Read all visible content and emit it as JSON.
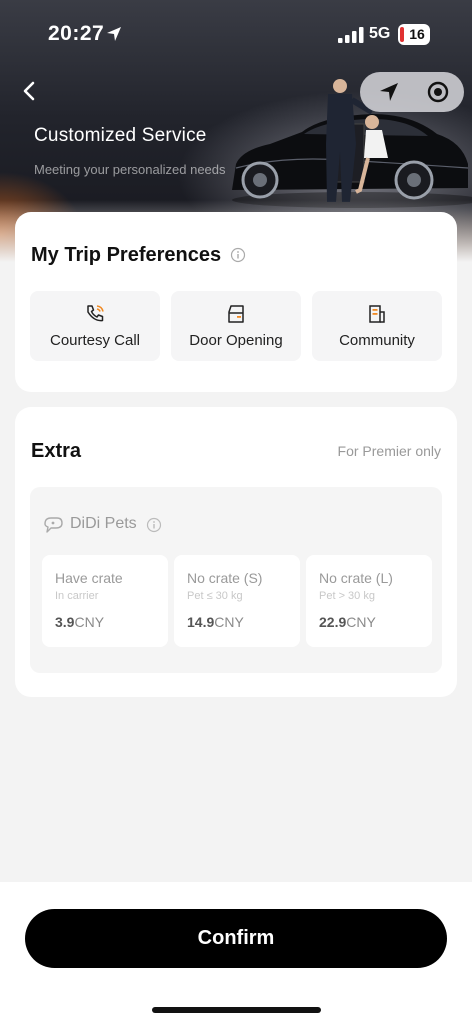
{
  "status_bar": {
    "time": "20:27",
    "network": "5G",
    "battery": "16"
  },
  "header": {
    "title": "Customized Service",
    "subtitle": "Meeting your personalized needs"
  },
  "preferences": {
    "title": "My Trip Preferences",
    "items": [
      {
        "label": "Courtesy Call",
        "icon": "phone-ring-icon"
      },
      {
        "label": "Door Opening",
        "icon": "car-door-icon"
      },
      {
        "label": "Community",
        "icon": "building-icon"
      }
    ]
  },
  "extra": {
    "title": "Extra",
    "note": "For Premier only",
    "pets": {
      "name": "DiDi Pets",
      "options": [
        {
          "title": "Have crate",
          "sub": "In carrier",
          "price": "3.9",
          "unit": "CNY"
        },
        {
          "title": "No crate (S)",
          "sub": "Pet ≤ 30 kg",
          "price": "14.9",
          "unit": "CNY"
        },
        {
          "title": "No crate (L)",
          "sub": "Pet > 30 kg",
          "price": "22.9",
          "unit": "CNY"
        }
      ]
    }
  },
  "confirm_label": "Confirm",
  "colors": {
    "accent_orange": "#f08a24",
    "button_bg": "#000000",
    "card_bg": "#ffffff",
    "page_bg": "#f3f3f3"
  }
}
